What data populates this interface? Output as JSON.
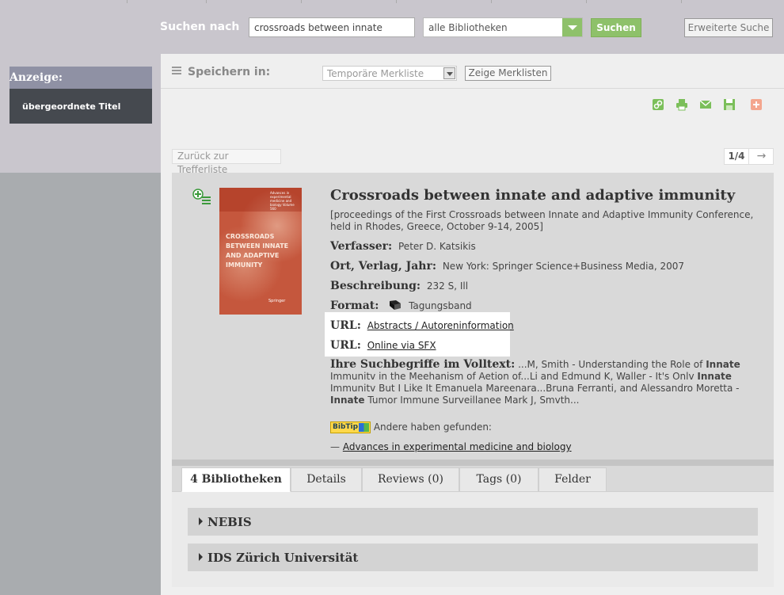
{
  "topbar": {
    "search_label": "Suchen nach",
    "search_value": "crossroads between innate",
    "library_select": "alle Bibliotheken",
    "search_button": "Suchen",
    "advanced_button": "Erweiterte Suche"
  },
  "sidebar": {
    "heading": "Anzeige:",
    "item": "übergeordnete Titel"
  },
  "savebar": {
    "label": "Speichern in:",
    "list_select": "Temporäre Merkliste",
    "show_button": "Zeige Merklisten"
  },
  "actions": [
    "link-icon",
    "print-icon",
    "email-icon",
    "save-icon",
    "add-icon"
  ],
  "navigation": {
    "back": "Zurück zur Trefferliste",
    "pager": "1/4",
    "next": "→"
  },
  "record": {
    "cover": {
      "title": "Crossroads between innate and adaptive immunity",
      "series": "Advances in experimental medicine and biology Volume 560",
      "publisher": "Springer"
    },
    "title": "Crossroads between innate and adaptive immunity",
    "subtitle": "[proceedings of the First Crossroads between Innate and Adaptive Immunity Conference, held in Rhodes, Greece, October 9-14, 2005]",
    "author_label": "Verfasser:",
    "author": "Peter D. Katsikis",
    "imprint_label": "Ort, Verlag, Jahr:",
    "imprint": "New York: Springer Science+Business Media, 2007",
    "desc_label": "Beschreibung:",
    "desc": "232 S, Ill",
    "format_label": "Format:",
    "format": "Tagungsband",
    "url1_label": "URL:",
    "url1": "Abstracts / Autoreninformation",
    "url2_label": "URL:",
    "url2": "Online via SFX",
    "fulltext_label": "Ihre Suchbegriffe im Volltext:",
    "fulltext_1": " ...M, Smith - Understanding the Role of ",
    "fulltext_b1": "Innate",
    "fulltext_2": " Immunitv in the Meehanism of Aetion of...Li and Edmund K, Waller - It's Onlv ",
    "fulltext_b2": "Innate",
    "fulltext_3": " Immunitv But I Like It Emanuela Mareenara...Bruna Ferranti, and Alessandro Moretta - ",
    "fulltext_b3": "Innate",
    "fulltext_4": " Tumor Immune Surveillanee Mark J, Smvth...",
    "bibtip_logo": "BibTip",
    "bibtip_text": "Andere haben gefunden:",
    "related_bullet": "—",
    "related_link": "Advances in experimental medicine and biology"
  },
  "tabs": [
    "4 Bibliotheken",
    "Details",
    "Reviews (0)",
    "Tags (0)",
    "Felder"
  ],
  "libraries": [
    "NEBIS",
    "IDS Zürich Universität"
  ]
}
